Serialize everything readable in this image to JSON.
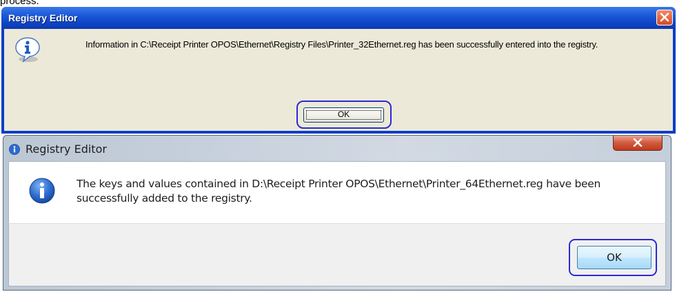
{
  "page_fragment": "process.",
  "dialog_xp": {
    "title": "Registry Editor",
    "message": "Information in C:\\Receipt Printer OPOS\\Ethernet\\Registry Files\\Printer_32Ethernet.reg has been successfully entered into the registry.",
    "ok_label": "OK",
    "icon": "info-icon",
    "close_icon": "close-icon"
  },
  "dialog_win7": {
    "title": "Registry Editor",
    "message": "The keys and values contained in D:\\Receipt Printer OPOS\\Ethernet\\Printer_64Ethernet.reg have been successfully added to the registry.",
    "ok_label": "OK",
    "icon": "info-icon",
    "close_icon": "close-icon"
  },
  "colors": {
    "highlight_ring": "#2a2ad8",
    "xp_titlebar": "#0f46c8",
    "win7_close": "#c03a1c"
  }
}
